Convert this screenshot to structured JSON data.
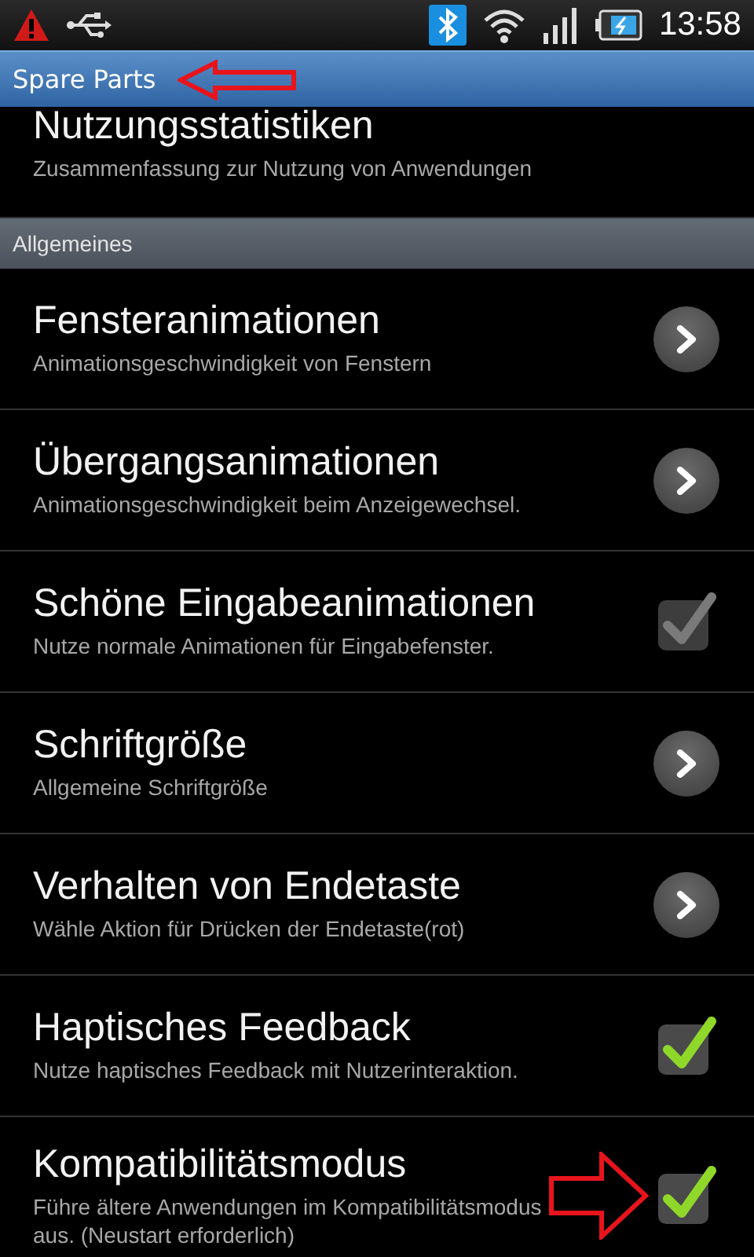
{
  "status_bar": {
    "time": "13:58"
  },
  "title_bar": {
    "title": "Spare Parts"
  },
  "top_item": {
    "title": "Nutzungsstatistiken",
    "summary": "Zusammenfassung zur Nutzung von Anwendungen"
  },
  "section": {
    "title": "Allgemeines"
  },
  "items": [
    {
      "kind": "chevron",
      "title": "Fensteranimationen",
      "summary": "Animationsgeschwindigkeit von Fenstern"
    },
    {
      "kind": "chevron",
      "title": "Übergangsanimationen",
      "summary": "Animationsgeschwindigkeit beim Anzeigewechsel."
    },
    {
      "kind": "checkbox",
      "title": "Schöne Eingabeanimationen",
      "summary": "Nutze normale Animationen für Eingabefenster.",
      "checked": true,
      "disabled": true
    },
    {
      "kind": "chevron",
      "title": "Schriftgröße",
      "summary": "Allgemeine Schriftgröße"
    },
    {
      "kind": "chevron",
      "title": "Verhalten von Endetaste",
      "summary": "Wähle Aktion für Drücken der Endetaste(rot)"
    },
    {
      "kind": "checkbox",
      "title": "Haptisches Feedback",
      "summary": "Nutze haptisches Feedback mit Nutzerinteraktion.",
      "checked": true,
      "disabled": false
    },
    {
      "kind": "checkbox",
      "title": "Kompatibilitätsmodus",
      "summary": "Führe ältere Anwendungen im Kompatibilitätsmodus aus. (Neustart erforderlich)",
      "checked": true,
      "disabled": false
    }
  ]
}
